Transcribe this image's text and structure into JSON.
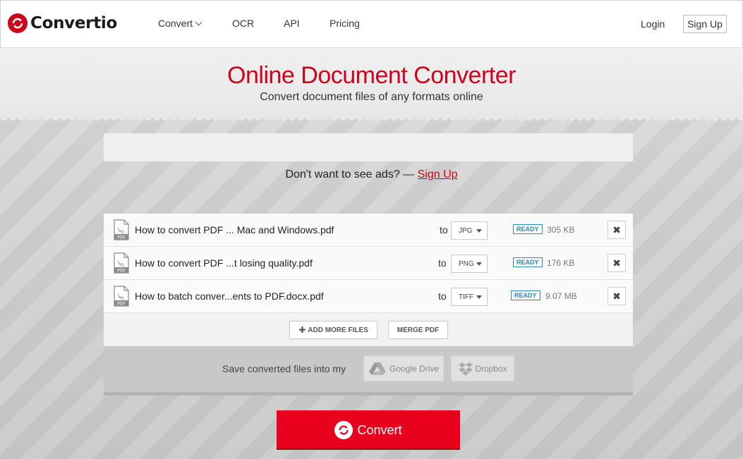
{
  "header": {
    "logo": "Convertio",
    "nav": {
      "convert": "Convert",
      "ocr": "OCR",
      "api": "API",
      "pricing": "Pricing"
    },
    "login": "Login",
    "signup": "Sign Up"
  },
  "hero": {
    "title": "Online Document Converter",
    "subtitle": "Convert document files of any formats online"
  },
  "ads": {
    "text": "Don't want to see ads? — ",
    "link": "Sign Up"
  },
  "files": [
    {
      "name": "How to convert PDF ... Mac and Windows.pdf",
      "to": "to",
      "format": "JPG",
      "status": "READY",
      "size": "305 KB",
      "icon": "pdf-file-icon"
    },
    {
      "name": "How to convert PDF ...t losing quality.pdf",
      "to": "to",
      "format": "PNG",
      "status": "READY",
      "size": "176 KB",
      "icon": "pdf-file-icon"
    },
    {
      "name": "How to batch conver...ents to PDF.docx.pdf",
      "to": "to",
      "format": "TIFF",
      "status": "READY",
      "size": "9.07 MB",
      "icon": "pdf-file-icon"
    }
  ],
  "actions": {
    "add_more": "ADD MORE FILES",
    "merge": "MERGE PDF"
  },
  "save": {
    "text": "Save converted files into my",
    "gdrive": "Google Drive",
    "dropbox": "Dropbox"
  },
  "convert_label": "Convert",
  "colors": {
    "brand": "#d0021b",
    "convert_button": "#e8001c",
    "ready_badge": "#2a8ab5"
  }
}
